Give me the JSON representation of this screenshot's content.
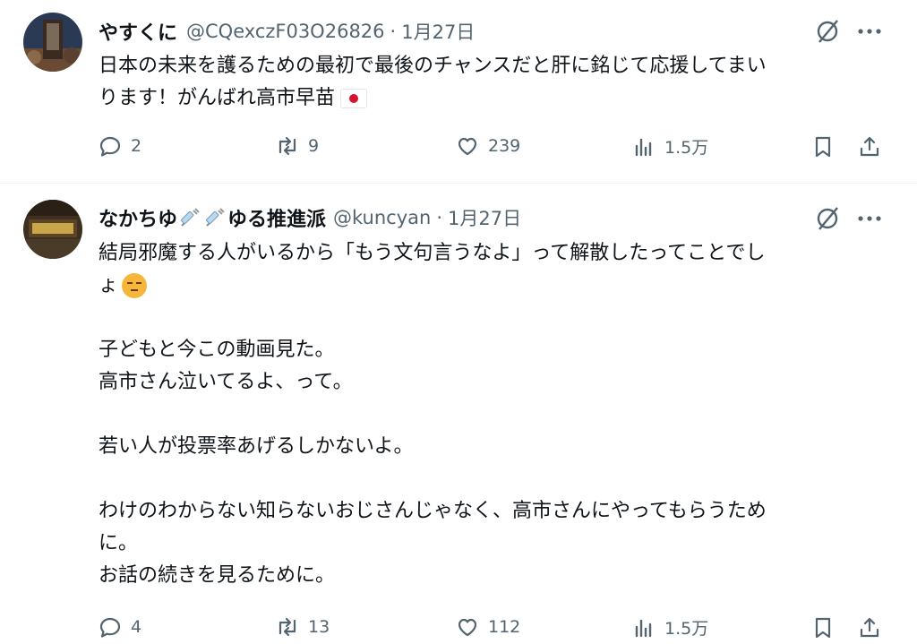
{
  "tweets": [
    {
      "display_name": "やすくに",
      "handle": "@CQexczF03O26826",
      "separator": "·",
      "date": "1月27日",
      "body_lines": [
        "日本の未来を護るための最初で最後のチャンスだと肝に銘じて応援してまい",
        "ります！がんばれ高市早苗"
      ],
      "replies": "2",
      "reposts": "9",
      "likes": "239",
      "views": "1.5万"
    },
    {
      "display_name_prefix": "なかちゆ",
      "display_name_suffix": "ゆる推進派",
      "handle": "@kuncyan",
      "separator": "·",
      "date": "1月27日",
      "paragraphs": [
        [
          "結局邪魔する人がいるから「もう文句言うなよ」って解散したってことでし",
          "ょ"
        ],
        [
          "子どもと今この動画見た。",
          "高市さん泣いてるよ、って。"
        ],
        [
          "若い人が投票率あげるしかないよ。"
        ],
        [
          "わけのわからない知らないおじさんじゃなく、高市さんにやってもらうため",
          "に。",
          "お話の続きを見るために。"
        ]
      ],
      "replies": "4",
      "reposts": "13",
      "likes": "112",
      "views": "1.5万"
    }
  ],
  "icons": {
    "reply": "reply-icon",
    "repost": "repost-icon",
    "like": "like-icon",
    "views": "views-icon",
    "bookmark": "bookmark-icon",
    "share": "share-icon",
    "grok": "grok-icon",
    "more": "more-icon",
    "flag": "japan-flag-emoji",
    "face": "pensive-face-emoji",
    "syringe": "syringe-emoji"
  },
  "colors": {
    "text": "#0f1419",
    "secondary": "#536471",
    "divider": "#eff3f4"
  }
}
